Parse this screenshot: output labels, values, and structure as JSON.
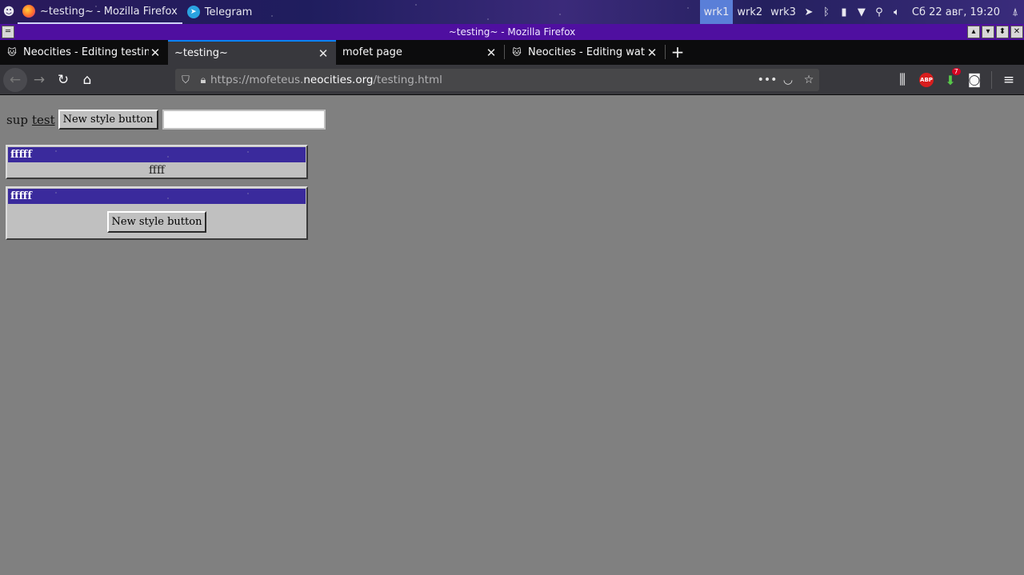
{
  "taskbar": {
    "apps": [
      {
        "label": "~testing~ - Mozilla Firefox",
        "active": true
      },
      {
        "label": "Telegram",
        "active": false
      }
    ],
    "workspaces": [
      "wrk1",
      "wrk2",
      "wrk3"
    ],
    "clock": "Сб 22 авг, 19:20"
  },
  "window": {
    "title": "~testing~ - Mozilla Firefox"
  },
  "tabs": [
    {
      "label": "Neocities - Editing testing",
      "selected": false
    },
    {
      "label": "~testing~",
      "selected": true
    },
    {
      "label": "mofet page",
      "selected": false
    },
    {
      "label": "Neocities - Editing wat.css",
      "selected": false
    }
  ],
  "urlbar": {
    "scheme_prefix": "https://mofeteus.",
    "host": "neocities.org",
    "path": "/testing.html"
  },
  "toolbar": {
    "download_badge": "7",
    "abp_label": "ABP"
  },
  "page": {
    "sup_text": "sup",
    "link_text": "test",
    "button_label": "New style button",
    "input_value": "",
    "window1": {
      "title": "fffff",
      "body": "ffff"
    },
    "window2": {
      "title": "fffff",
      "button_label": "New style button"
    }
  },
  "colors": {
    "page_bg": "#808080",
    "win_title": "#3a2a9c",
    "os_title": "#4f0fa0",
    "tab_accent": "#0a84ff"
  }
}
